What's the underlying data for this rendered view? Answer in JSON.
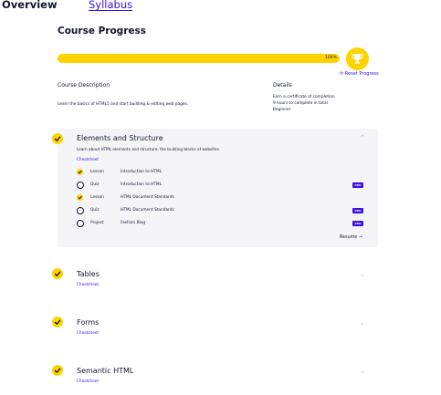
{
  "tabs": {
    "overview": "Overview",
    "syllabus": "Syllabus"
  },
  "course": {
    "title": "Course Progress",
    "progress_text": "100%",
    "progress": 1.0,
    "reset_label": "Reset Progress",
    "description_heading": "Course Description",
    "description": "Learn the basics of HTML5 and start building & editing web pages.",
    "details_heading": "Details",
    "details": [
      "Earn a certificate of completion",
      "9 hours to complete in total",
      "Beginner"
    ]
  },
  "modules": [
    {
      "title": "Elements and Structure",
      "description": "Learn about HTML elements and structure, the building blocks of websites.",
      "cheatsheet": "Cheatsheet",
      "items": [
        {
          "type": "Lesson",
          "name": "Introduction to HTML",
          "done": true,
          "pro": false
        },
        {
          "type": "Quiz",
          "name": "Introduction to HTML",
          "done": false,
          "pro": true
        },
        {
          "type": "Lesson",
          "name": "HTML Document Standards",
          "done": true,
          "pro": false
        },
        {
          "type": "Quiz",
          "name": "HTML Document Standards",
          "done": false,
          "pro": true
        },
        {
          "type": "Project",
          "name": "Fashion Blog",
          "done": false,
          "pro": true
        }
      ],
      "resume_label": "Resume",
      "pro_label": "PRO"
    },
    {
      "title": "Tables",
      "cheatsheet": "Cheatsheet"
    },
    {
      "title": "Forms",
      "cheatsheet": "Cheatsheet"
    },
    {
      "title": "Semantic HTML",
      "cheatsheet": "Cheatsheet"
    }
  ],
  "colors": {
    "accent": "#3a10e5",
    "yellow": "#ffd300",
    "text": "#10162f"
  },
  "icons": {
    "check": "check-icon",
    "trophy": "trophy-icon",
    "reset": "reset-icon",
    "chevron": "chevron-icon"
  }
}
